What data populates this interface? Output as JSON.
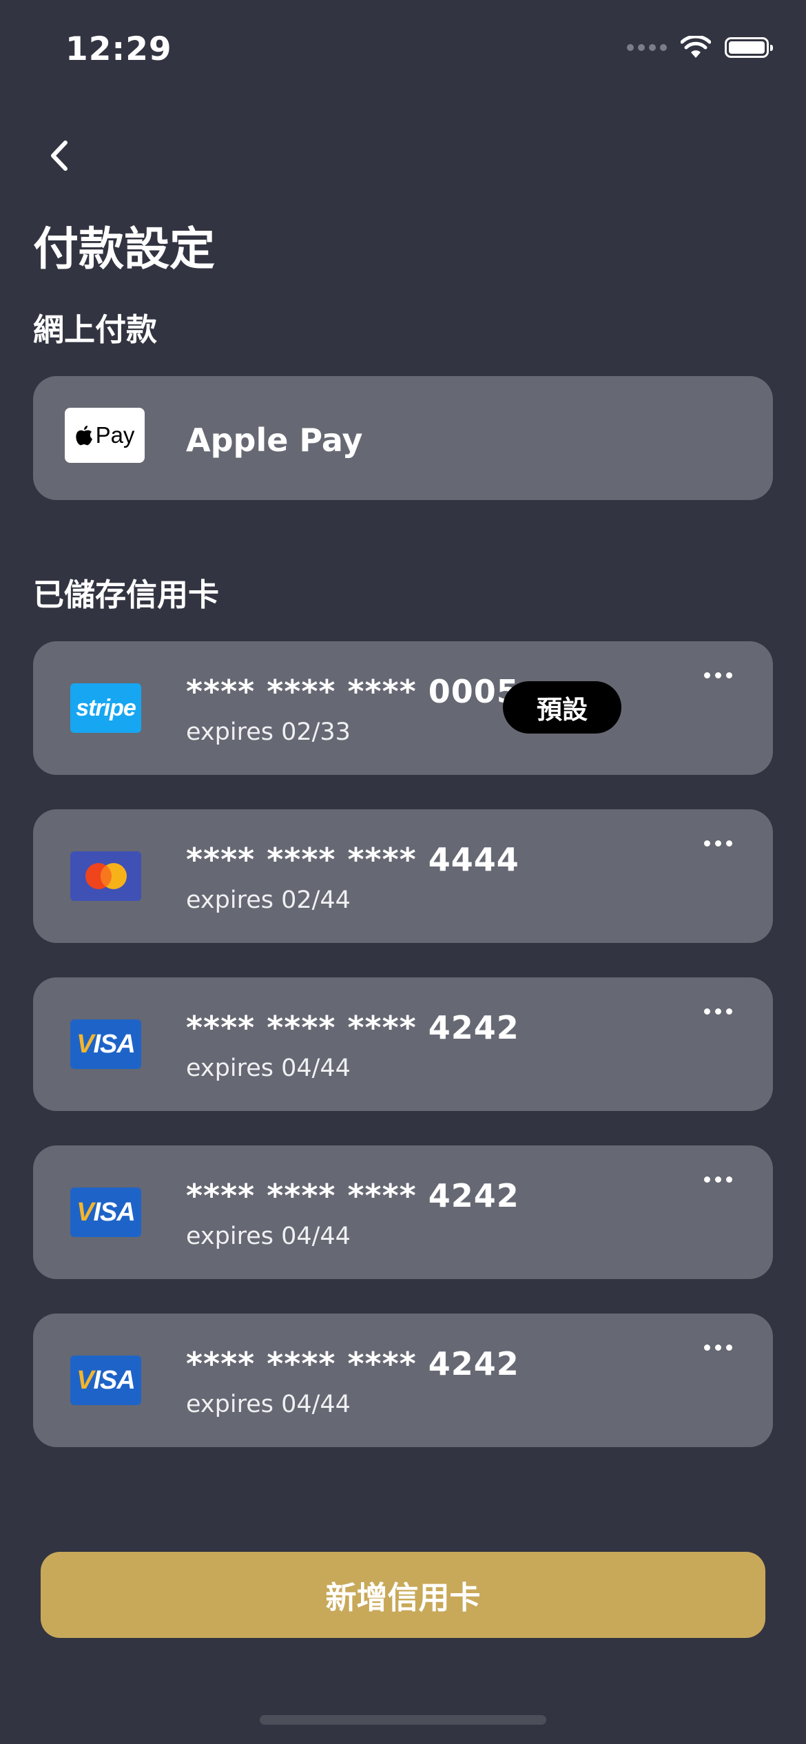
{
  "status_bar": {
    "time": "12:29"
  },
  "header": {
    "title": "付款設定"
  },
  "online_payment": {
    "section_title": "網上付款",
    "apple_pay": {
      "logo_text": "Pay",
      "label": "Apple Pay"
    }
  },
  "saved_cards": {
    "section_title": "已儲存信用卡",
    "cards": [
      {
        "brand": "stripe",
        "brand_logo_text": "stripe",
        "number": "**** **** **** 0005",
        "expiry": "expires 02/33",
        "default_badge": "預設"
      },
      {
        "brand": "mastercard",
        "number": "**** **** **** 4444",
        "expiry": "expires 02/44"
      },
      {
        "brand": "visa",
        "brand_logo_text": "VISA",
        "number": "**** **** **** 4242",
        "expiry": "expires 04/44"
      },
      {
        "brand": "visa",
        "brand_logo_text": "VISA",
        "number": "**** **** **** 4242",
        "expiry": "expires 04/44"
      },
      {
        "brand": "visa",
        "brand_logo_text": "VISA",
        "number": "**** **** **** 4242",
        "expiry": "expires 04/44"
      }
    ]
  },
  "add_card_button": {
    "label": "新增信用卡"
  },
  "colors": {
    "background": "#323441",
    "card": "#666873",
    "accent": "#c8a95a",
    "stripe_blue": "#17a6f2",
    "visa_blue": "#1e64c8",
    "mastercard_bg": "#3f51b5"
  },
  "icons": [
    "back-chevron-icon",
    "apple-logo-icon",
    "more-options-icon",
    "wifi-icon",
    "battery-icon",
    "signal-icon"
  ]
}
